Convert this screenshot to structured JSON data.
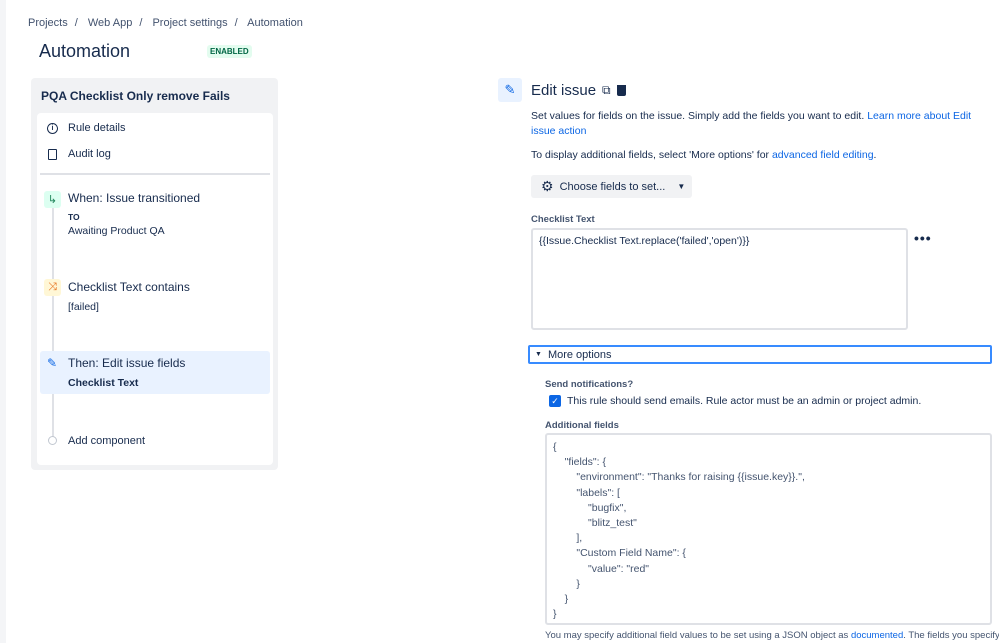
{
  "breadcrumbs": [
    "Projects",
    "Web App",
    "Project settings",
    "Automation"
  ],
  "page_title": "Automation",
  "status_badge": "ENABLED",
  "rule": {
    "name": "PQA Checklist Only remove Fails",
    "menu": [
      {
        "label": "Rule details",
        "icon": "info-icon"
      },
      {
        "label": "Audit log",
        "icon": "audit-log-icon"
      }
    ],
    "steps": [
      {
        "title": "When: Issue transitioned",
        "sub_label": "TO",
        "sub": "Awaiting Product QA",
        "icon": "transition-icon"
      },
      {
        "title": "Checklist Text contains",
        "sub": "[failed]",
        "icon": "condition-icon"
      },
      {
        "title": "Then: Edit issue fields",
        "sub": "Checklist Text",
        "icon": "pencil-icon"
      }
    ],
    "add_component": "Add component"
  },
  "editor": {
    "title": "Edit issue",
    "desc": "Set values for fields on the issue. Simply add the fields you want to edit. ",
    "desc_link": "Learn more about Edit issue action",
    "desc2": "To display additional fields, select 'More options' for ",
    "desc2_link": "advanced field editing",
    "desc2_end": ".",
    "choose_fields": "Choose fields to set...",
    "field_label": "Checklist Text",
    "field_value": "{{Issue.Checklist Text.replace('failed','open')}}",
    "more_options": "More options",
    "send_notifications_label": "Send notifications?",
    "send_notifications_text": "This rule should send emails. Rule actor must be an admin or project admin.",
    "send_notifications_checked": true,
    "additional_fields_label": "Additional fields",
    "additional_fields_value": "{\n    \"fields\": {\n        \"environment\": \"Thanks for raising {{issue.key}}.\",\n        \"labels\": [\n            \"bugfix\",\n            \"blitz_test\"\n        ],\n        \"Custom Field Name\": {\n            \"value\": \"red\"\n        }\n    }\n}",
    "footer": "You may specify additional field values to be set using a JSON object as ",
    "footer_link": "documented",
    "footer_end": ". The fields you specify"
  }
}
